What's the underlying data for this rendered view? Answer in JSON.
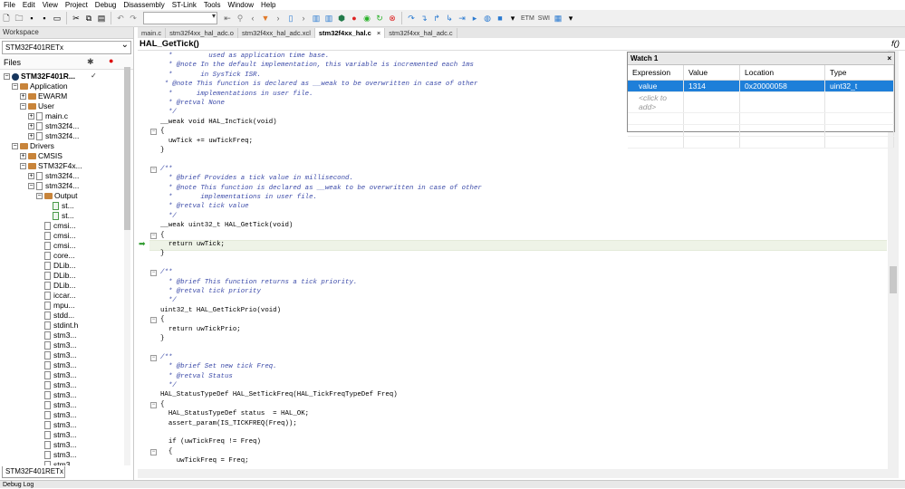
{
  "menu": [
    "File",
    "Edit",
    "View",
    "Project",
    "Debug",
    "Disassembly",
    "ST-Link",
    "Tools",
    "Window",
    "Help"
  ],
  "toolbar": {
    "text1": "ETM",
    "text2": "SWI"
  },
  "workspace": {
    "title": "Workspace",
    "config": "STM32F401RETx",
    "files_header": "Files",
    "bottom_tab": "STM32F401RETx",
    "tree": [
      {
        "label": "STM32F401R...",
        "icon": "project-icon",
        "level": 0,
        "exp": "−",
        "bold": true,
        "check": "✓"
      },
      {
        "label": "Application",
        "icon": "folder-icon",
        "level": 1,
        "exp": "−"
      },
      {
        "label": "EWARM",
        "icon": "folder-icon",
        "level": 2,
        "exp": "+"
      },
      {
        "label": "User",
        "icon": "folder-icon",
        "level": 2,
        "exp": "−"
      },
      {
        "label": "main.c",
        "icon": "file-icon",
        "level": 3,
        "exp": "+"
      },
      {
        "label": "stm32f4...",
        "icon": "file-icon",
        "level": 3,
        "exp": "+"
      },
      {
        "label": "stm32f4...",
        "icon": "file-icon",
        "level": 3,
        "exp": "+"
      },
      {
        "label": "Drivers",
        "icon": "folder-icon",
        "level": 1,
        "exp": "−"
      },
      {
        "label": "CMSIS",
        "icon": "folder-icon",
        "level": 2,
        "exp": "+"
      },
      {
        "label": "STM32F4x...",
        "icon": "folder-icon",
        "level": 2,
        "exp": "−"
      },
      {
        "label": "stm32f4...",
        "icon": "file-icon",
        "level": 3,
        "exp": "+"
      },
      {
        "label": "stm32f4...",
        "icon": "file-icon",
        "level": 3,
        "exp": "−"
      },
      {
        "label": "Output",
        "icon": "folder-icon",
        "level": 4,
        "exp": "−"
      },
      {
        "label": "st...",
        "icon": "file-icon",
        "level": 5,
        "exp": ""
      },
      {
        "label": "st...",
        "icon": "file-icon",
        "level": 5,
        "exp": ""
      },
      {
        "label": "cmsi...",
        "icon": "file-icon",
        "level": 4,
        "exp": ""
      },
      {
        "label": "cmsi...",
        "icon": "file-icon",
        "level": 4,
        "exp": ""
      },
      {
        "label": "cmsi...",
        "icon": "file-icon",
        "level": 4,
        "exp": ""
      },
      {
        "label": "core...",
        "icon": "file-icon",
        "level": 4,
        "exp": ""
      },
      {
        "label": "DLib...",
        "icon": "file-icon",
        "level": 4,
        "exp": ""
      },
      {
        "label": "DLib...",
        "icon": "file-icon",
        "level": 4,
        "exp": ""
      },
      {
        "label": "DLib...",
        "icon": "file-icon",
        "level": 4,
        "exp": ""
      },
      {
        "label": "iccar...",
        "icon": "file-icon",
        "level": 4,
        "exp": ""
      },
      {
        "label": "mpu...",
        "icon": "file-icon",
        "level": 4,
        "exp": ""
      },
      {
        "label": "stdd...",
        "icon": "file-icon",
        "level": 4,
        "exp": ""
      },
      {
        "label": "stdint.h",
        "icon": "file-icon",
        "level": 4,
        "exp": ""
      },
      {
        "label": "stm3...",
        "icon": "file-icon",
        "level": 4,
        "exp": ""
      },
      {
        "label": "stm3...",
        "icon": "file-icon",
        "level": 4,
        "exp": ""
      },
      {
        "label": "stm3...",
        "icon": "file-icon",
        "level": 4,
        "exp": ""
      },
      {
        "label": "stm3...",
        "icon": "file-icon",
        "level": 4,
        "exp": ""
      },
      {
        "label": "stm3...",
        "icon": "file-icon",
        "level": 4,
        "exp": ""
      },
      {
        "label": "stm3...",
        "icon": "file-icon",
        "level": 4,
        "exp": ""
      },
      {
        "label": "stm3...",
        "icon": "file-icon",
        "level": 4,
        "exp": ""
      },
      {
        "label": "stm3...",
        "icon": "file-icon",
        "level": 4,
        "exp": ""
      },
      {
        "label": "stm3...",
        "icon": "file-icon",
        "level": 4,
        "exp": ""
      },
      {
        "label": "stm3...",
        "icon": "file-icon",
        "level": 4,
        "exp": ""
      },
      {
        "label": "stm3...",
        "icon": "file-icon",
        "level": 4,
        "exp": ""
      },
      {
        "label": "stm3...",
        "icon": "file-icon",
        "level": 4,
        "exp": ""
      },
      {
        "label": "stm3...",
        "icon": "file-icon",
        "level": 4,
        "exp": ""
      },
      {
        "label": "stm3...",
        "icon": "file-icon",
        "level": 4,
        "exp": ""
      }
    ]
  },
  "tabs": [
    {
      "label": "main.c",
      "active": false
    },
    {
      "label": "stm32f4xx_hal_adc.o",
      "active": false
    },
    {
      "label": "stm32f4xx_hal_adc.xcl",
      "active": false
    },
    {
      "label": "stm32f4xx_hal.c",
      "active": true
    },
    {
      "label": "stm32f4xx_hal_adc.c",
      "active": false
    }
  ],
  "function_bar": {
    "name": "HAL_GetTick()",
    "fx": "f()"
  },
  "code": [
    {
      "t": "  *         used as application time base.",
      "c": true
    },
    {
      "t": "  * @note In the default implementation, this variable is incremented each 1ms",
      "c": true
    },
    {
      "t": "  *       in SysTick ISR.",
      "c": true
    },
    {
      "t": " * @note This function is declared as __weak to be overwritten in case of other",
      "c": true
    },
    {
      "t": "  *      implementations in user file.",
      "c": true
    },
    {
      "t": "  * @retval None",
      "c": true
    },
    {
      "t": "  */",
      "c": true
    },
    {
      "t": "__weak void HAL_IncTick(void)",
      "c": false
    },
    {
      "t": "{",
      "c": false,
      "fold": true
    },
    {
      "t": "  uwTick += uwTickFreq;",
      "c": false
    },
    {
      "t": "}",
      "c": false
    },
    {
      "t": "",
      "c": false
    },
    {
      "t": "/**",
      "c": true,
      "fold": true
    },
    {
      "t": "  * @brief Provides a tick value in millisecond.",
      "c": true
    },
    {
      "t": "  * @note This function is declared as __weak to be overwritten in case of other",
      "c": true
    },
    {
      "t": "  *       implementations in user file.",
      "c": true
    },
    {
      "t": "  * @retval tick value",
      "c": true
    },
    {
      "t": "  */",
      "c": true
    },
    {
      "t": "__weak uint32_t HAL_GetTick(void)",
      "c": false
    },
    {
      "t": "{",
      "c": false,
      "fold": true
    },
    {
      "t": "  return uwTick;",
      "c": false,
      "hl": true
    },
    {
      "t": "}",
      "c": false
    },
    {
      "t": "",
      "c": false
    },
    {
      "t": "/**",
      "c": true,
      "fold": true
    },
    {
      "t": "  * @brief This function returns a tick priority.",
      "c": true
    },
    {
      "t": "  * @retval tick priority",
      "c": true
    },
    {
      "t": "  */",
      "c": true
    },
    {
      "t": "uint32_t HAL_GetTickPrio(void)",
      "c": false
    },
    {
      "t": "{",
      "c": false,
      "fold": true
    },
    {
      "t": "  return uwTickPrio;",
      "c": false
    },
    {
      "t": "}",
      "c": false
    },
    {
      "t": "",
      "c": false
    },
    {
      "t": "/**",
      "c": true,
      "fold": true
    },
    {
      "t": "  * @brief Set new tick Freq.",
      "c": true
    },
    {
      "t": "  * @retval Status",
      "c": true
    },
    {
      "t": "  */",
      "c": true
    },
    {
      "t": "HAL_StatusTypeDef HAL_SetTickFreq(HAL_TickFreqTypeDef Freq)",
      "c": false
    },
    {
      "t": "{",
      "c": false,
      "fold": true
    },
    {
      "t": "  HAL_StatusTypeDef status  = HAL_OK;",
      "c": false
    },
    {
      "t": "  assert_param(IS_TICKFREQ(Freq));",
      "c": false
    },
    {
      "t": "",
      "c": false
    },
    {
      "t": "  if (uwTickFreq != Freq)",
      "c": false
    },
    {
      "t": "  {",
      "c": false,
      "fold": true
    },
    {
      "t": "    uwTickFreq = Freq;",
      "c": false
    }
  ],
  "watch": {
    "title": "Watch 1",
    "columns": [
      "Expression",
      "Value",
      "Location",
      "Type"
    ],
    "rows": [
      {
        "expression": "value",
        "value": "1314",
        "location": "0x20000058",
        "type": "uint32_t"
      }
    ],
    "add_placeholder": "<click to add>"
  },
  "bottom_label": "Debug Log"
}
